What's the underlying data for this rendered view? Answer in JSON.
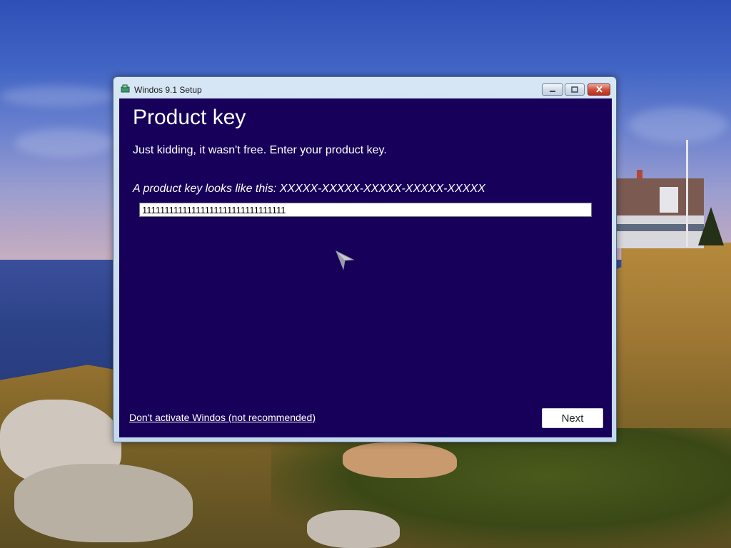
{
  "window": {
    "title": "Windos 9.1 Setup",
    "icon": "setup-icon",
    "controls": [
      "minimize-icon",
      "maximize-icon",
      "close-icon"
    ]
  },
  "page": {
    "heading": "Product key",
    "subtitle": "Just kidding, it wasn't free. Enter your product key.",
    "hint": "A product key looks like this: XXXXX-XXXXX-XXXXX-XXXXX-XXXXX"
  },
  "product_key_input": {
    "value": "11111111111111111111111111111111"
  },
  "footer": {
    "skip_link": "Don't activate Windos (not recommended)",
    "next_label": "Next"
  },
  "colors": {
    "content_background": "#17005a",
    "text": "#ffffff",
    "close_button": "#c7402c"
  },
  "cursor": "mouse-pointer-icon"
}
